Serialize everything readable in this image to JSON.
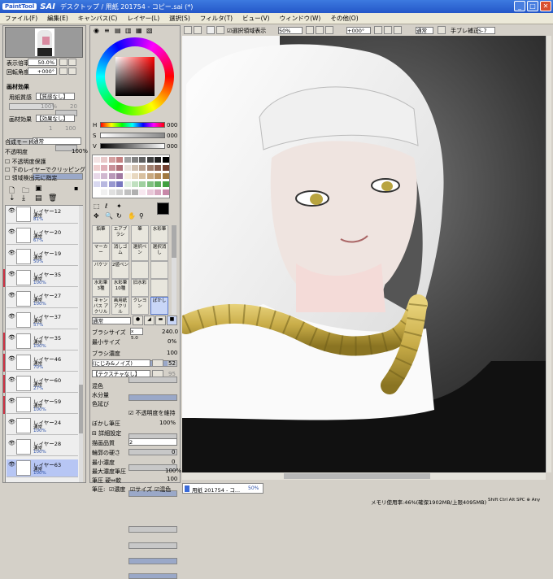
{
  "window": {
    "logo": "PaintTool",
    "app": "SAI",
    "title": "デスクトップ / 用紙 201754 - コピー.sai (*)",
    "min": "_",
    "max": "□",
    "close": "✕"
  },
  "menu": [
    "ファイル(F)",
    "編集(E)",
    "キャンバス(C)",
    "レイヤー(L)",
    "選択(S)",
    "フィルタ(T)",
    "ビュー(V)",
    "ウィンドウ(W)",
    "その他(O)"
  ],
  "nav": {
    "zoom_label": "表示倍率",
    "zoom": "50.0%",
    "rot_label": "回転角度",
    "rot": "+000°"
  },
  "paper": {
    "header": "画材効果",
    "texture_label": "用紙質感",
    "texture": "【質感なし】",
    "effect_label": "画材効果",
    "effect": "【効果なし】",
    "v1": "100%",
    "v2": "20",
    "v3": "1",
    "v4": "100"
  },
  "blend": {
    "label": "合成モード",
    "value": "通常",
    "op_label": "不透明度",
    "op": "100%",
    "c1": "不透明度保護",
    "c2": "下のレイヤーでクリッピング",
    "c3": "領域検出元に指定"
  },
  "layers": [
    {
      "name": "レイヤー12",
      "mode": "通常",
      "op": "81%",
      "red": false,
      "sel": false
    },
    {
      "name": "レイヤー20",
      "mode": "通常",
      "op": "67%",
      "red": false,
      "sel": false
    },
    {
      "name": "レイヤー19",
      "mode": "通常",
      "op": "50%",
      "red": false,
      "sel": false
    },
    {
      "name": "レイヤー35",
      "mode": "通常",
      "op": "100%",
      "red": true,
      "sel": false
    },
    {
      "name": "レイヤー27",
      "mode": "通常",
      "op": "100%",
      "red": false,
      "sel": false
    },
    {
      "name": "レイヤー37",
      "mode": "通常",
      "op": "57%",
      "red": false,
      "sel": false
    },
    {
      "name": "レイヤー35",
      "mode": "通常",
      "op": "100%",
      "red": true,
      "sel": false
    },
    {
      "name": "レイヤー46",
      "mode": "通常",
      "op": "70%",
      "red": true,
      "sel": false
    },
    {
      "name": "レイヤー60",
      "mode": "通常",
      "op": "27%",
      "red": true,
      "sel": false
    },
    {
      "name": "レイヤー59",
      "mode": "通常",
      "op": "100%",
      "red": true,
      "sel": false
    },
    {
      "name": "レイヤー24",
      "mode": "通常",
      "op": "100%",
      "red": false,
      "sel": false
    },
    {
      "name": "レイヤー28",
      "mode": "通常",
      "op": "100%",
      "red": false,
      "sel": false
    },
    {
      "name": "レイヤー63",
      "mode": "通常",
      "op": "100%",
      "red": false,
      "sel": true
    }
  ],
  "color": {
    "h": "H",
    "s": "S",
    "v": "V",
    "hv": "000",
    "sv": "000",
    "vv": "000",
    "fg": "#000000",
    "bg": "#ffffff"
  },
  "tools": [
    {
      "t": "鉛筆",
      "s": false
    },
    {
      "t": "エアブラシ",
      "s": false
    },
    {
      "t": "筆",
      "s": false
    },
    {
      "t": "水彩筆",
      "s": false
    },
    {
      "t": "マーカー",
      "s": false
    },
    {
      "t": "消しゴム",
      "s": false
    },
    {
      "t": "選択ペン",
      "s": false
    },
    {
      "t": "選択消し",
      "s": false
    },
    {
      "t": "バケツ",
      "s": false
    },
    {
      "t": "2値ペン",
      "s": false
    },
    {
      "t": "",
      "s": false
    },
    {
      "t": "",
      "s": false
    },
    {
      "t": "水彩筆 3種",
      "s": false
    },
    {
      "t": "水彩筆 10種",
      "s": false
    },
    {
      "t": "旧水彩",
      "s": false
    },
    {
      "t": "",
      "s": false
    },
    {
      "t": "キャンバス アクリル",
      "s": false
    },
    {
      "t": "画用紙 アクリル",
      "s": false
    },
    {
      "t": "クレヨン",
      "s": false
    },
    {
      "t": "ぼかし",
      "s": true
    }
  ],
  "brush": {
    "mode": "通常",
    "size_label": "ブラシサイズ",
    "size_mult": "x 5.0",
    "size": "240.0",
    "min_label": "最小サイズ",
    "min": "0%",
    "dens_label": "ブラシ濃度",
    "dens": "100",
    "shape": "(にじみ&ノイズ)",
    "shape_v": "52",
    "tex": "【テクスチャなし】",
    "tex_v": "95",
    "mix_label": "混色",
    "water_label": "水分量",
    "ext_label": "色延び",
    "blur_label": "ぼかし筆圧",
    "blur": "100%",
    "keep_label": "不透明度を維持",
    "detail": "詳細設定",
    "q_label": "描画品質",
    "q": "2",
    "edge_label": "輪郭の硬さ",
    "edge": "0",
    "mind_label": "最小濃度",
    "mind": "0",
    "maxp_label": "最大濃度筆圧",
    "maxp": "100%",
    "hard_label": "筆圧 硬⇔軟",
    "hard": "100",
    "press_label": "筆圧:",
    "p1": "濃度",
    "p2": "サイズ",
    "p3": "混色"
  },
  "toolbar": {
    "sel_view": "選択領域表示",
    "zoom": "50%",
    "rot": "+000°",
    "mode": "通常",
    "stab_label": "手ブレ補正",
    "stab": "S-7"
  },
  "status": {
    "tab": "用紙 201754 - コ...",
    "tab_zoom": "50%",
    "mem": "メモリ使用率:46%(確保1902MB/上限4095MB)",
    "keys": "Shift Ctrl Alt SPC ⊕ Any"
  }
}
